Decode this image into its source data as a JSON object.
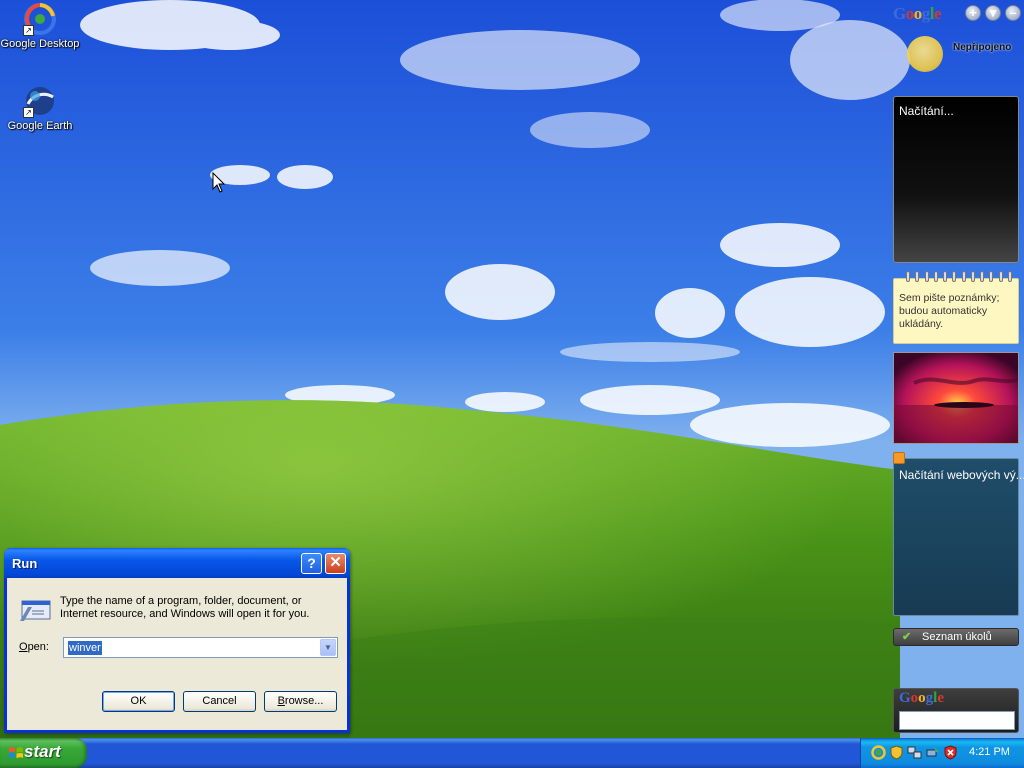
{
  "desktop": {
    "icons": [
      {
        "label": "Google Desktop"
      },
      {
        "label": "Google Earth"
      }
    ]
  },
  "sidebar": {
    "logo": "Google",
    "status": "Nepřipojeno",
    "loading_panel": "Načítání...",
    "notes_panel": "Sem pište poznámky; budou automaticky ukládány.",
    "news_panel": "Načítání webových vý...",
    "tasks_button": "Seznam úkolů",
    "search_logo": "Google",
    "search_value": ""
  },
  "run_dialog": {
    "title": "Run",
    "help_label": "?",
    "close_label": "✕",
    "description": "Type the name of a program, folder, document, or Internet resource, and Windows will open it for you.",
    "open_label_prefix": "",
    "open_label_ul": "O",
    "open_label_rest": "pen:",
    "open_value": "winver",
    "ok_label": "OK",
    "cancel_label": "Cancel",
    "browse_label_ul": "B",
    "browse_label_rest": "rowse..."
  },
  "taskbar": {
    "start_label": "start",
    "clock": "4:21 PM"
  },
  "colors": {
    "sky": "#2f6fe0",
    "hill": "#4f9a1d",
    "titlebar": "#0757e8",
    "taskbar": "#2156d6",
    "start_green": "#37a837"
  }
}
